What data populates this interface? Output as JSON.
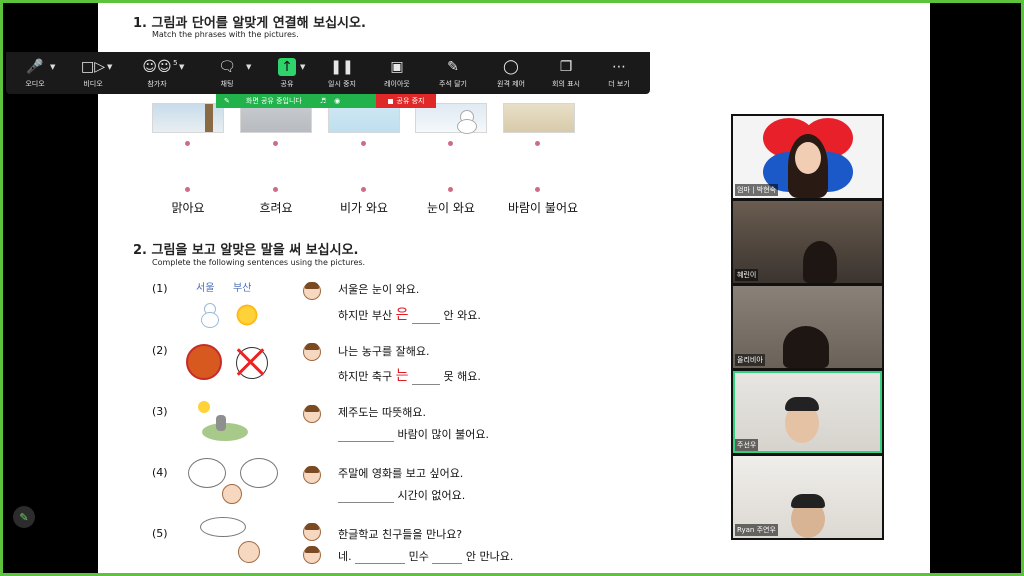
{
  "document": {
    "q1": {
      "title": "1.  그림과 단어를 알맞게 연결해 보십시오.",
      "subtitle": "Match the phrases with the pictures.",
      "words": [
        "맑아요",
        "흐려요",
        "비가 와요",
        "눈이 와요",
        "바람이 불어요"
      ]
    },
    "q2": {
      "title": "2.  그림을 보고 알맞은 말을 써 보십시오.",
      "subtitle": "Complete the following sentences using the pictures.",
      "items": [
        {
          "num": "(1)",
          "pic_labels": [
            "서울",
            "부산"
          ],
          "line1": "서울은 눈이 와요.",
          "line2_pre": "하지만 부산",
          "line2_red": "은",
          "line2_post": "안 와요."
        },
        {
          "num": "(2)",
          "line1": "나는 농구를 잘해요.",
          "line2_pre": "하지만 축구",
          "line2_red": "는",
          "line2_post": "못 해요."
        },
        {
          "num": "(3)",
          "line1": "제주도는 따뜻해요.",
          "line2_post": "바람이 많이 불어요."
        },
        {
          "num": "(4)",
          "line1": "주말에 영화를 보고 싶어요.",
          "line2_post": "시간이 없어요."
        },
        {
          "num": "(5)",
          "line1": "한글학교 친구들을 만나요?",
          "line2_pre": "네.",
          "line2_mid": "민수",
          "line2_post": "안 만나요."
        }
      ]
    }
  },
  "toolbar": {
    "audio": "오디오",
    "video": "비디오",
    "participants": "참가자",
    "participants_count": "5",
    "chat": "채팅",
    "share": "공유",
    "pause": "일시 중지",
    "layout": "레이아웃",
    "annotate": "주석 달기",
    "remote_control": "원격 제어",
    "meeting_view": "회의 표시",
    "more": "더 보기"
  },
  "share_status": {
    "sharing_label": "화면 공유 중입니다",
    "stop_label": "공유 중지"
  },
  "participants": [
    {
      "name": "엄마 | 박현숙"
    },
    {
      "name": "혜린이"
    },
    {
      "name": "올리비아"
    },
    {
      "name": "주선우"
    },
    {
      "name": "Ryan 주연우"
    }
  ],
  "colors": {
    "share_green": "#22b24c",
    "stop_red": "#e02828",
    "active_speaker": "#35d07f",
    "frame_green": "#5cc43c"
  }
}
